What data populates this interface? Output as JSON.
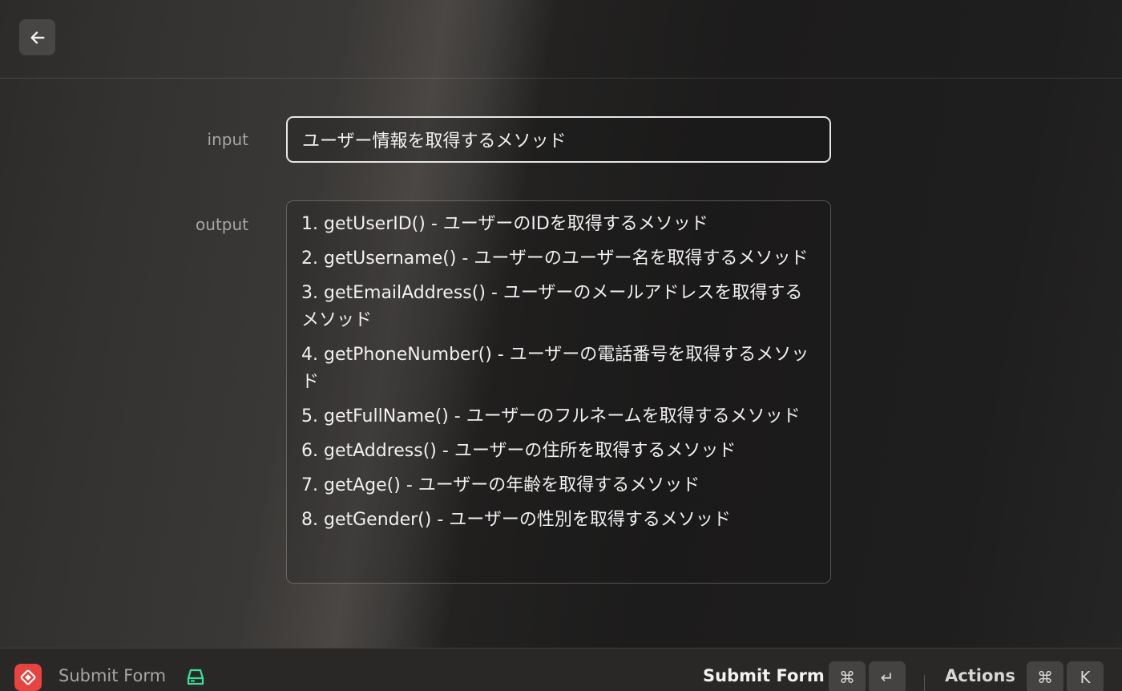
{
  "header": {
    "back_icon": "arrow-left-icon"
  },
  "form": {
    "input": {
      "label": "input",
      "value": "ユーザー情報を取得するメソッド"
    },
    "output": {
      "label": "output",
      "lines": [
        "1. getUserID() - ユーザーのIDを取得するメソッド",
        "2. getUsername() - ユーザーのユーザー名を取得するメソッド",
        "3. getEmailAddress() - ユーザーのメールアドレスを取得するメソッド",
        "4. getPhoneNumber() - ユーザーの電話番号を取得するメソッド",
        "5. getFullName() - ユーザーのフルネームを取得するメソッド",
        "6. getAddress() - ユーザーの住所を取得するメソッド",
        "7. getAge() - ユーザーの年齢を取得するメソッド",
        "8. getGender() - ユーザーの性別を取得するメソッド"
      ]
    }
  },
  "footer": {
    "app_icon": "app-icon",
    "title": "Submit Form",
    "storage_icon": "storage-icon",
    "primary_action": "Submit Form",
    "primary_shortcut": [
      "⌘",
      "↵"
    ],
    "actions_label": "Actions",
    "actions_shortcut": [
      "⌘",
      "K"
    ],
    "accent_color": "#3ddc97",
    "app_icon_color": "#e8443f"
  }
}
